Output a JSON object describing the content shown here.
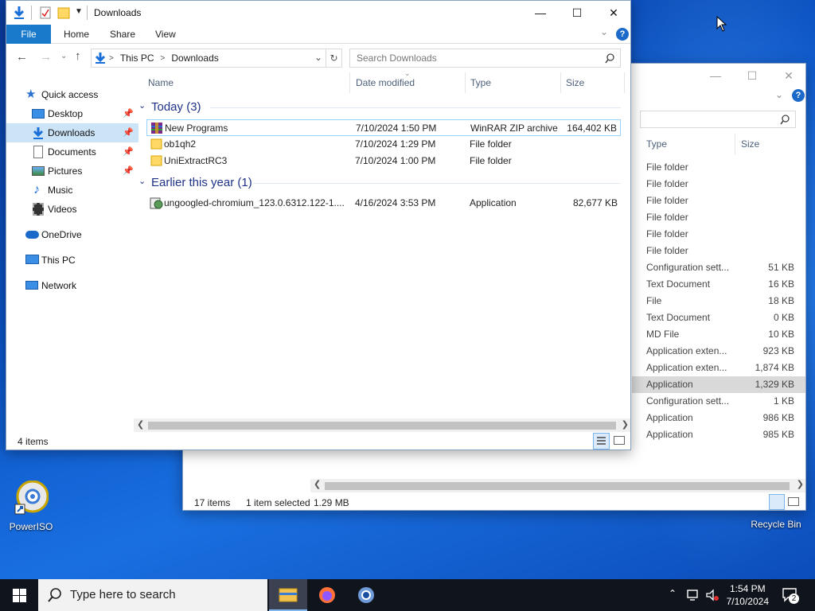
{
  "desktop": {
    "icons": [
      {
        "label": "PowerISO",
        "icon": "poweriso-disc-icon"
      },
      {
        "label": "Recycle Bin",
        "icon": "recycle-bin-icon"
      }
    ]
  },
  "back_window": {
    "columns": {
      "type": "Type",
      "size": "Size"
    },
    "rows": [
      {
        "type": "File folder",
        "size": ""
      },
      {
        "type": "File folder",
        "size": ""
      },
      {
        "type": "File folder",
        "size": ""
      },
      {
        "type": "File folder",
        "size": ""
      },
      {
        "type": "File folder",
        "size": ""
      },
      {
        "type": "File folder",
        "size": ""
      },
      {
        "type": "Configuration sett...",
        "size": "51 KB"
      },
      {
        "type": "Text Document",
        "size": "16 KB"
      },
      {
        "type": "File",
        "size": "18 KB"
      },
      {
        "type": "Text Document",
        "size": "0 KB"
      },
      {
        "type": "MD File",
        "size": "10 KB"
      },
      {
        "type": "Application exten...",
        "size": "923 KB"
      },
      {
        "type": "Application exten...",
        "size": "1,874 KB"
      },
      {
        "type": "Application",
        "size": "1,329 KB"
      },
      {
        "type": "Configuration sett...",
        "size": "1 KB"
      },
      {
        "type": "Application",
        "size": "986 KB"
      },
      {
        "type": "Application",
        "size": "985 KB"
      }
    ],
    "status": {
      "items": "17 items",
      "selected": "1 item selected",
      "size": "1.29 MB"
    }
  },
  "front_window": {
    "title": "Downloads",
    "ribbon": {
      "file": "File",
      "home": "Home",
      "share": "Share",
      "view": "View"
    },
    "address": {
      "root": "This PC",
      "sep": ">",
      "folder": "Downloads"
    },
    "search_placeholder": "Search Downloads",
    "nav": [
      {
        "label": "Quick access",
        "icon": "star-icon",
        "level": 1
      },
      {
        "label": "Desktop",
        "icon": "desktop-icon",
        "level": 2,
        "pinned": true
      },
      {
        "label": "Downloads",
        "icon": "download-arrow-icon",
        "level": 2,
        "pinned": true,
        "selected": true
      },
      {
        "label": "Documents",
        "icon": "documents-icon",
        "level": 2,
        "pinned": true
      },
      {
        "label": "Pictures",
        "icon": "pictures-icon",
        "level": 2,
        "pinned": true
      },
      {
        "label": "Music",
        "icon": "music-note-icon",
        "level": 2
      },
      {
        "label": "Videos",
        "icon": "videos-icon",
        "level": 2
      },
      {
        "label": "OneDrive",
        "icon": "cloud-icon",
        "level": 1
      },
      {
        "label": "This PC",
        "icon": "computer-icon",
        "level": 1
      },
      {
        "label": "Network",
        "icon": "network-icon",
        "level": 1
      }
    ],
    "columns": {
      "name": "Name",
      "date": "Date modified",
      "type": "Type",
      "size": "Size"
    },
    "groups": [
      {
        "title": "Today (3)",
        "files": [
          {
            "name": "New Programs",
            "date": "7/10/2024 1:50 PM",
            "type": "WinRAR ZIP archive",
            "size": "164,402 KB",
            "icon": "winrar-archive-icon"
          },
          {
            "name": "ob1qh2",
            "date": "7/10/2024 1:29 PM",
            "type": "File folder",
            "size": "",
            "icon": "folder-icon"
          },
          {
            "name": "UniExtractRC3",
            "date": "7/10/2024 1:00 PM",
            "type": "File folder",
            "size": "",
            "icon": "folder-icon"
          }
        ]
      },
      {
        "title": "Earlier this year (1)",
        "files": [
          {
            "name": "ungoogled-chromium_123.0.6312.122-1....",
            "date": "4/16/2024 3:53 PM",
            "type": "Application",
            "size": "82,677 KB",
            "icon": "installer-app-icon"
          }
        ]
      }
    ],
    "status": "4 items"
  },
  "taskbar": {
    "search_placeholder": "Type here to search",
    "time": "1:54 PM",
    "date": "7/10/2024",
    "notification_count": "2"
  }
}
